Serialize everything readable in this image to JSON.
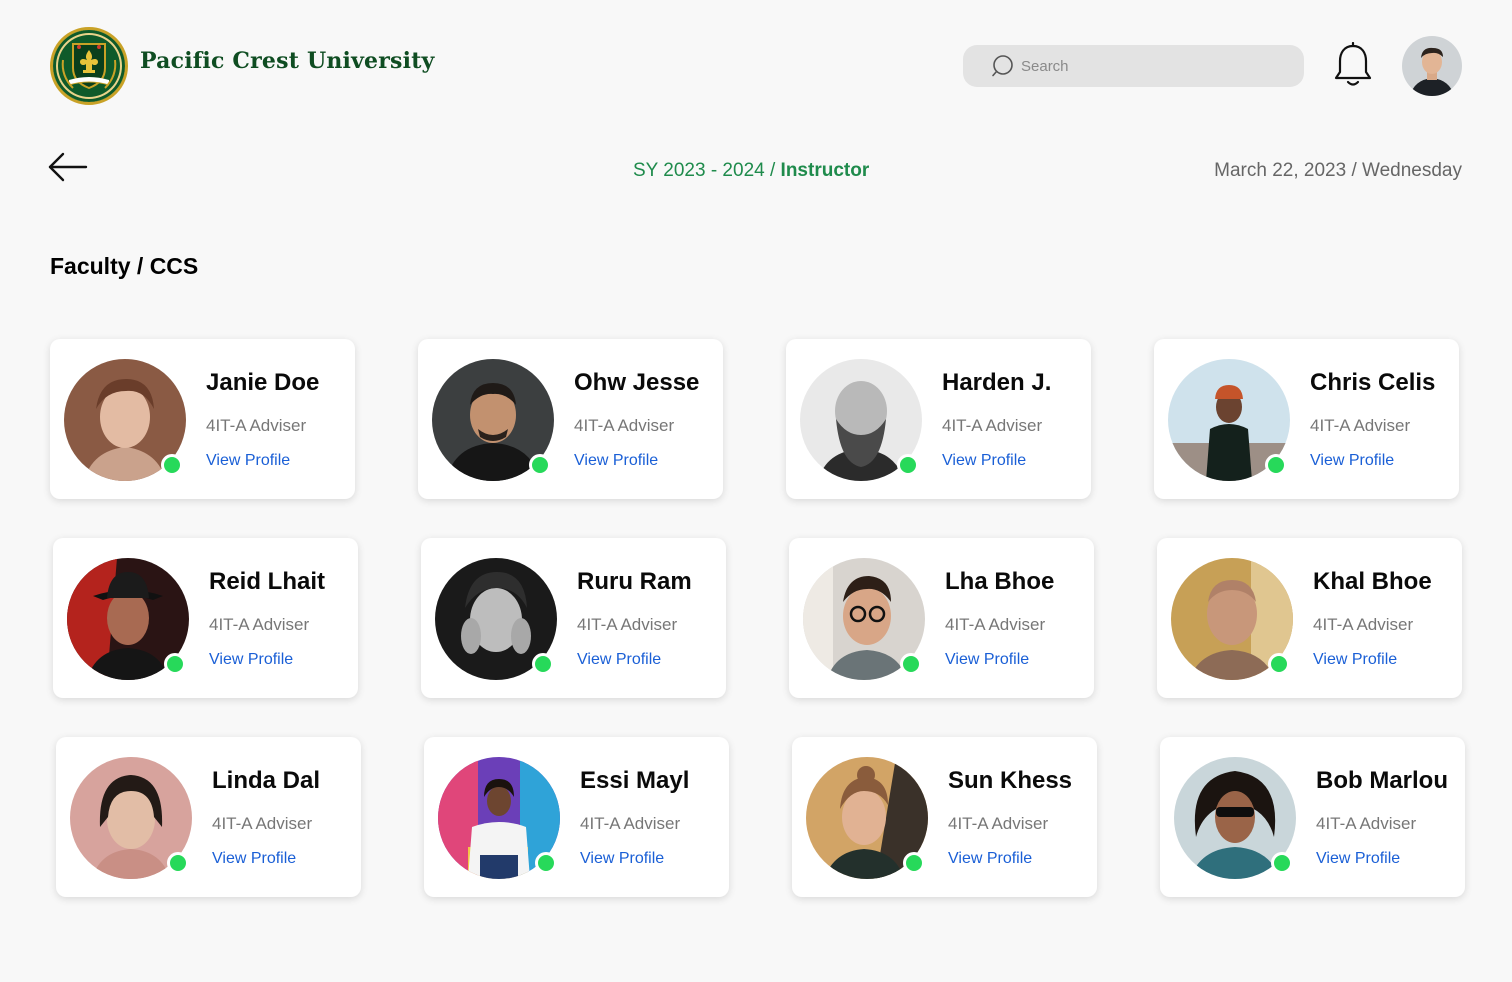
{
  "brand": {
    "name": "Pacific Crest University",
    "logo_icon": "fleur-de-lis-seal-icon",
    "colors": {
      "primary_green": "#0f5a2a",
      "gold": "#c9a227"
    }
  },
  "header": {
    "search": {
      "placeholder": "Search",
      "value": ""
    },
    "notifications_icon": "bell-icon",
    "user_avatar_icon": "user-avatar"
  },
  "subheader": {
    "back_icon": "arrow-left-icon",
    "school_year": "SY 2023 - 2024",
    "separator": "/",
    "role": "Instructor",
    "date": "March 22, 2023",
    "date_separator": "/",
    "weekday": "Wednesday"
  },
  "page_title": "Faculty / CCS",
  "colors": {
    "accent_green": "#1f8b4c",
    "link_blue": "#1a5fd6",
    "online_status": "#27d95a"
  },
  "faculty": [
    {
      "name": "Janie Doe",
      "role": "4IT-A Adviser",
      "link": "View Profile",
      "status": "online"
    },
    {
      "name": "Ohw Jesse",
      "role": "4IT-A Adviser",
      "link": "View Profile",
      "status": "online"
    },
    {
      "name": "Harden J.",
      "role": "4IT-A Adviser",
      "link": "View Profile",
      "status": "online"
    },
    {
      "name": "Chris Celis",
      "role": "4IT-A Adviser",
      "link": "View Profile",
      "status": "online"
    },
    {
      "name": "Reid Lhait",
      "role": "4IT-A Adviser",
      "link": "View Profile",
      "status": "online"
    },
    {
      "name": "Ruru Ram",
      "role": "4IT-A Adviser",
      "link": "View Profile",
      "status": "online"
    },
    {
      "name": "Lha Bhoe",
      "role": "4IT-A Adviser",
      "link": "View Profile",
      "status": "online"
    },
    {
      "name": "Khal Bhoe",
      "role": "4IT-A Adviser",
      "link": "View Profile",
      "status": "online"
    },
    {
      "name": "Linda Dal",
      "role": "4IT-A Adviser",
      "link": "View Profile",
      "status": "online"
    },
    {
      "name": "Essi Mayl",
      "role": "4IT-A Adviser",
      "link": "View Profile",
      "status": "online"
    },
    {
      "name": "Sun Khess",
      "role": "4IT-A Adviser",
      "link": "View Profile",
      "status": "online"
    },
    {
      "name": "Bob Marlou",
      "role": "4IT-A Adviser",
      "link": "View Profile",
      "status": "online"
    }
  ]
}
